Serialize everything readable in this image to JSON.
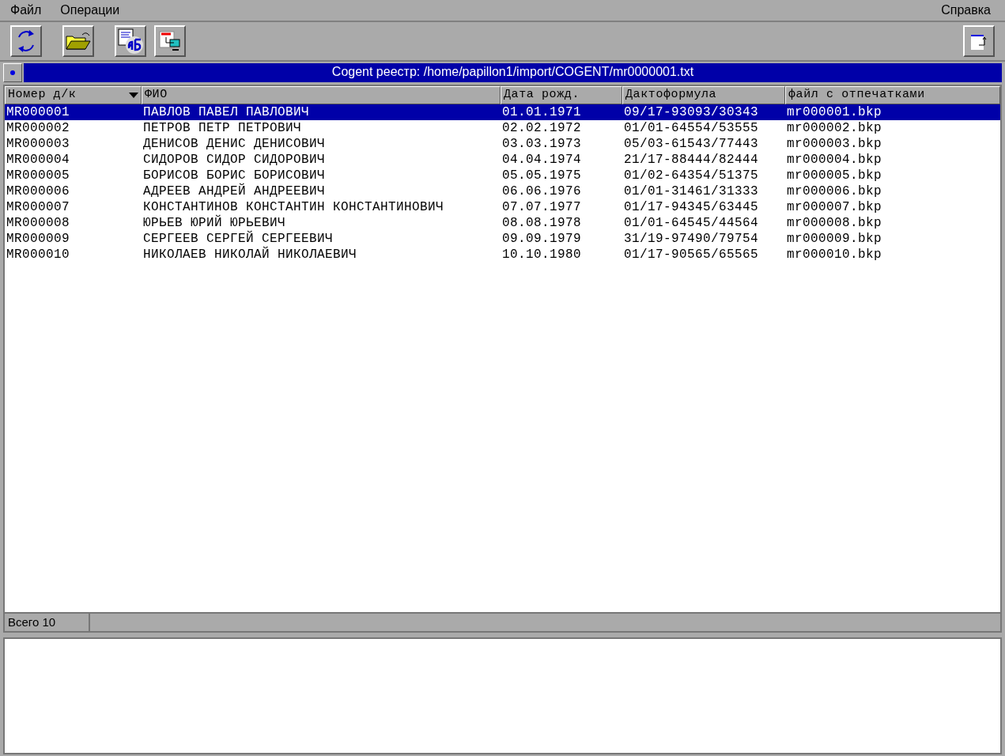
{
  "menu": [
    {
      "label": "Файл"
    },
    {
      "label": "Операции"
    }
  ],
  "help_menu": {
    "label": "Справка"
  },
  "path_bar": {
    "title": "Cogent реестр: /home/papillon1/import/COGENT/mr0000001.txt"
  },
  "table": {
    "columns": [
      {
        "label": "Номер д/к",
        "sorted": true
      },
      {
        "label": "ФИО",
        "sorted": false
      },
      {
        "label": "Дата рожд.",
        "sorted": false
      },
      {
        "label": "Дактоформула",
        "sorted": false
      },
      {
        "label": "файл с отпечатками",
        "sorted": false
      }
    ],
    "rows": [
      {
        "selected": true,
        "cells": [
          "MR000001",
          "ПАВЛОВ ПАВЕЛ ПАВЛОВИЧ",
          "01.01.1971",
          "09/17-93093/30343",
          "mr000001.bkp"
        ]
      },
      {
        "selected": false,
        "cells": [
          "MR000002",
          "ПЕТРОВ ПЕТР ПЕТРОВИЧ",
          "02.02.1972",
          "01/01-64554/53555",
          "mr000002.bkp"
        ]
      },
      {
        "selected": false,
        "cells": [
          "MR000003",
          "ДЕНИСОВ ДЕНИС ДЕНИСОВИЧ",
          "03.03.1973",
          "05/03-61543/77443",
          "mr000003.bkp"
        ]
      },
      {
        "selected": false,
        "cells": [
          "MR000004",
          "СИДОРОВ СИДОР СИДОРОВИЧ",
          "04.04.1974",
          "21/17-88444/82444",
          "mr000004.bkp"
        ]
      },
      {
        "selected": false,
        "cells": [
          "MR000005",
          "БОРИСОВ БОРИС БОРИСОВИЧ",
          "05.05.1975",
          "01/02-64354/51375",
          "mr000005.bkp"
        ]
      },
      {
        "selected": false,
        "cells": [
          "MR000006",
          "АДРЕЕВ АНДРЕЙ АНДРЕЕВИЧ",
          "06.06.1976",
          "01/01-31461/31333",
          "mr000006.bkp"
        ]
      },
      {
        "selected": false,
        "cells": [
          "MR000007",
          "КОНСТАНТИНОВ КОНСТАНТИН КОНСТАНТИНОВИЧ",
          "07.07.1977",
          "01/17-94345/63445",
          "mr000007.bkp"
        ]
      },
      {
        "selected": false,
        "cells": [
          "MR000008",
          "ЮРЬЕВ ЮРИЙ ЮРЬЕВИЧ",
          "08.08.1978",
          "01/01-64545/44564",
          "mr000008.bkp"
        ]
      },
      {
        "selected": false,
        "cells": [
          "MR000009",
          "СЕРГЕЕВ СЕРГЕЙ СЕРГЕЕВИЧ",
          "09.09.1979",
          "31/19-97490/79754",
          "mr000009.bkp"
        ]
      },
      {
        "selected": false,
        "cells": [
          "MR000010",
          "НИКОЛАЕВ НИКОЛАЙ НИКОЛАЕВИЧ",
          "10.10.1980",
          "01/17-90565/65565",
          "mr000010.bkp"
        ]
      }
    ]
  },
  "status_bar": {
    "total": "Всего 10"
  }
}
